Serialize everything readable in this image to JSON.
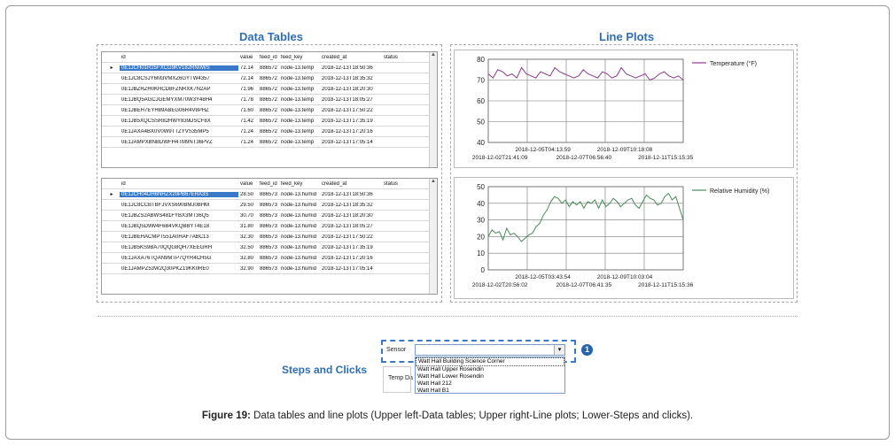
{
  "titles": {
    "data_tables": "Data Tables",
    "line_plots": "Line Plots",
    "steps": "Steps and Clicks"
  },
  "columns": [
    "id",
    "value",
    "feed_id",
    "feed_key",
    "created_at",
    "status"
  ],
  "temp_table": {
    "rows": [
      [
        "0E1JCH01R25FXCG9KV182RN0WS",
        "72.14",
        "886572",
        "node-13.temp",
        "2018-12-13T18:50:36"
      ],
      [
        "0E1JC8CSJY6M3VMXZ6GYTW4357",
        "72.14",
        "886572",
        "node-13.temp",
        "2018-12-13T18:35:32"
      ],
      [
        "0E1JBZRZH0KHCD8FZNRXK7N2AP",
        "71.96",
        "886572",
        "node-13.temp",
        "2018-12-13T18:20:30"
      ],
      [
        "0E1JBQ5AGCJGEMYXM70W3Y48H4",
        "71.78",
        "886572",
        "node-13.temp",
        "2018-12-13T18:05:27"
      ],
      [
        "0E1JBEH7EYH89ABEG06R4V8PHZ",
        "71.60",
        "886572",
        "node-13.temp",
        "2018-12-13T17:50:22"
      ],
      [
        "0E1JB5XQCSSR82HWY839DSCF8X",
        "71.42",
        "886572",
        "node-13.temp",
        "2018-12-13T17:35:19"
      ],
      [
        "0E1JAXA4BX0V0W9TTZYVS35MP5",
        "71.24",
        "886572",
        "node-13.temp",
        "2018-12-13T17:20:16"
      ],
      [
        "0E1JAMPXBNBDWFH4TM9NT36PVZ",
        "71.24",
        "886572",
        "node-13.temp",
        "2018-12-13T17:05:14"
      ]
    ]
  },
  "hum_table": {
    "rows": [
      [
        "0E1JCH04DH6NHZX20PB67ERA3S",
        "28.50",
        "886573",
        "node-13.humid",
        "2018-12-13T18:50:36"
      ],
      [
        "0E1JC8CCBTBFJVXS690BMJ0BHM",
        "29.50",
        "886573",
        "node-13.humid",
        "2018-12-13T18:35:32"
      ],
      [
        "0E1JBZS2ABWS481FYBX3MT36Q5",
        "30.70",
        "886573",
        "node-13.humid",
        "2018-12-13T18:20:30"
      ],
      [
        "0E1JBQ5D9W4F6B4VKQBBYT4E18",
        "31.80",
        "886573",
        "node-13.humid",
        "2018-12-13T18:05:27"
      ],
      [
        "0E1JBEHACMPT551A0HAF7ABC13",
        "32.30",
        "886573",
        "node-13.humid",
        "2018-12-13T17:50:22"
      ],
      [
        "0E1JB5KS9BA70QQG8QH7XEEGRH",
        "32.50",
        "886573",
        "node-13.humid",
        "2018-12-13T17:35:19"
      ],
      [
        "0E1JAXA76TQAN9MTP7QYR4CH5G",
        "32.80",
        "886573",
        "node-13.humid",
        "2018-12-13T17:20:16"
      ],
      [
        "0E1JAMPZ53W2Q30PKZ19KK0RE0",
        "32.90",
        "886573",
        "node-13.humid",
        "2018-12-13T17:05:14"
      ]
    ]
  },
  "chart_data": [
    {
      "type": "line",
      "series": [
        {
          "name": "Temperature (°F)",
          "color": "#8b3a8b",
          "values": [
            73,
            71,
            75,
            74,
            72,
            73,
            71,
            76,
            73,
            72,
            71,
            74,
            73,
            72,
            76,
            74,
            73,
            72,
            71,
            72,
            75,
            73,
            72,
            71,
            74,
            73,
            71,
            72,
            76,
            73,
            72,
            71,
            72,
            73,
            70,
            71,
            73,
            74,
            72,
            71,
            72,
            70
          ]
        }
      ],
      "ylim": [
        40,
        80
      ],
      "yticks": [
        "40",
        "50",
        "60",
        "70",
        "80"
      ],
      "xticks_top": [
        "2018-12-05T04:13:59",
        "2018-12-09T10:18:08"
      ],
      "xticks_bottom": [
        "2018-12-02T21:41:09",
        "2018-12-07T06:56:40",
        "2018-12-11T15:15:35"
      ]
    },
    {
      "type": "line",
      "series": [
        {
          "name": "Relative Humidity (%)",
          "color": "#4a8a5a",
          "values": [
            20,
            24,
            22,
            23,
            18,
            25,
            21,
            22,
            20,
            17,
            19,
            21,
            22,
            26,
            28,
            33,
            36,
            41,
            44,
            43,
            40,
            42,
            38,
            41,
            39,
            41,
            37,
            41,
            40,
            42,
            37,
            42,
            38,
            40,
            43,
            41,
            38,
            40,
            42,
            43,
            39,
            37,
            41,
            45,
            43,
            42,
            39,
            40,
            44,
            46,
            42,
            44,
            37,
            30
          ]
        }
      ],
      "ylim": [
        0,
        50
      ],
      "yticks": [
        "0",
        "10",
        "20",
        "30",
        "40",
        "50"
      ],
      "xticks_top": [
        "2018-12-05T03:43:54",
        "2018-12-09T10:03:04"
      ],
      "xticks_bottom": [
        "2018-12-02T20:56:02",
        "2018-12-07T06:41:35",
        "2018-12-11T15:15:36"
      ]
    }
  ],
  "sensor": {
    "label": "Sensor",
    "temp_label": "Temp Da",
    "options": [
      "Watt Hall Building Science Corner",
      "Watt Hall Upper Rosendin",
      "Watt Hall Lower Rosendin",
      "Watt Hall 212",
      "Watt Hall B1"
    ],
    "badge": "1"
  },
  "caption": {
    "bold": "Figure 19:",
    "text": " Data tables and line plots (Upper left-Data tables; Upper right-Line plots; Lower-Steps and clicks)."
  }
}
